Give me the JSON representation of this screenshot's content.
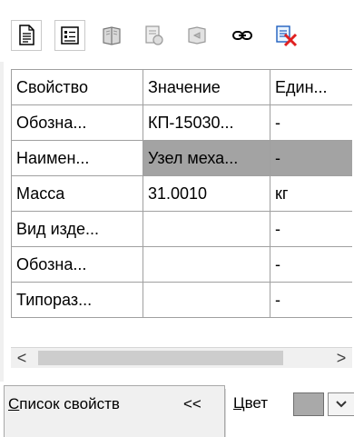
{
  "toolbar": {
    "buttons": [
      {
        "name": "document-icon"
      },
      {
        "name": "list-icon"
      },
      {
        "name": "book-icon"
      },
      {
        "name": "spec-icon"
      },
      {
        "name": "export-icon"
      },
      {
        "name": "link-icon"
      },
      {
        "name": "delete-icon"
      }
    ]
  },
  "table": {
    "headers": [
      "Свойство",
      "Значение",
      "Един..."
    ],
    "rows": [
      [
        "Обозна...",
        "КП-15030...",
        "-"
      ],
      [
        "Наимен...",
        "Узел меха...",
        "-"
      ],
      [
        "Масса",
        "31.0010",
        "кг"
      ],
      [
        "Вид изде...",
        "",
        "-"
      ],
      [
        "Обозна...",
        "",
        "-"
      ],
      [
        "Типораз...",
        "",
        "-"
      ]
    ],
    "selected_row_index": 1
  },
  "hscroll": {
    "left_arrow": "<",
    "right_arrow": ">"
  },
  "bottom": {
    "props_tab_first_letter": "С",
    "props_tab_rest": "писок свойств",
    "collapse_label": "<<",
    "color_label_first_letter": "Ц",
    "color_label_rest": "вет"
  },
  "colors": {
    "selected_row": "#a3a3a3",
    "swatch": "#a9a9a9",
    "delete_icon_red": "#e02020",
    "grid_line": "#a0a0a0"
  }
}
